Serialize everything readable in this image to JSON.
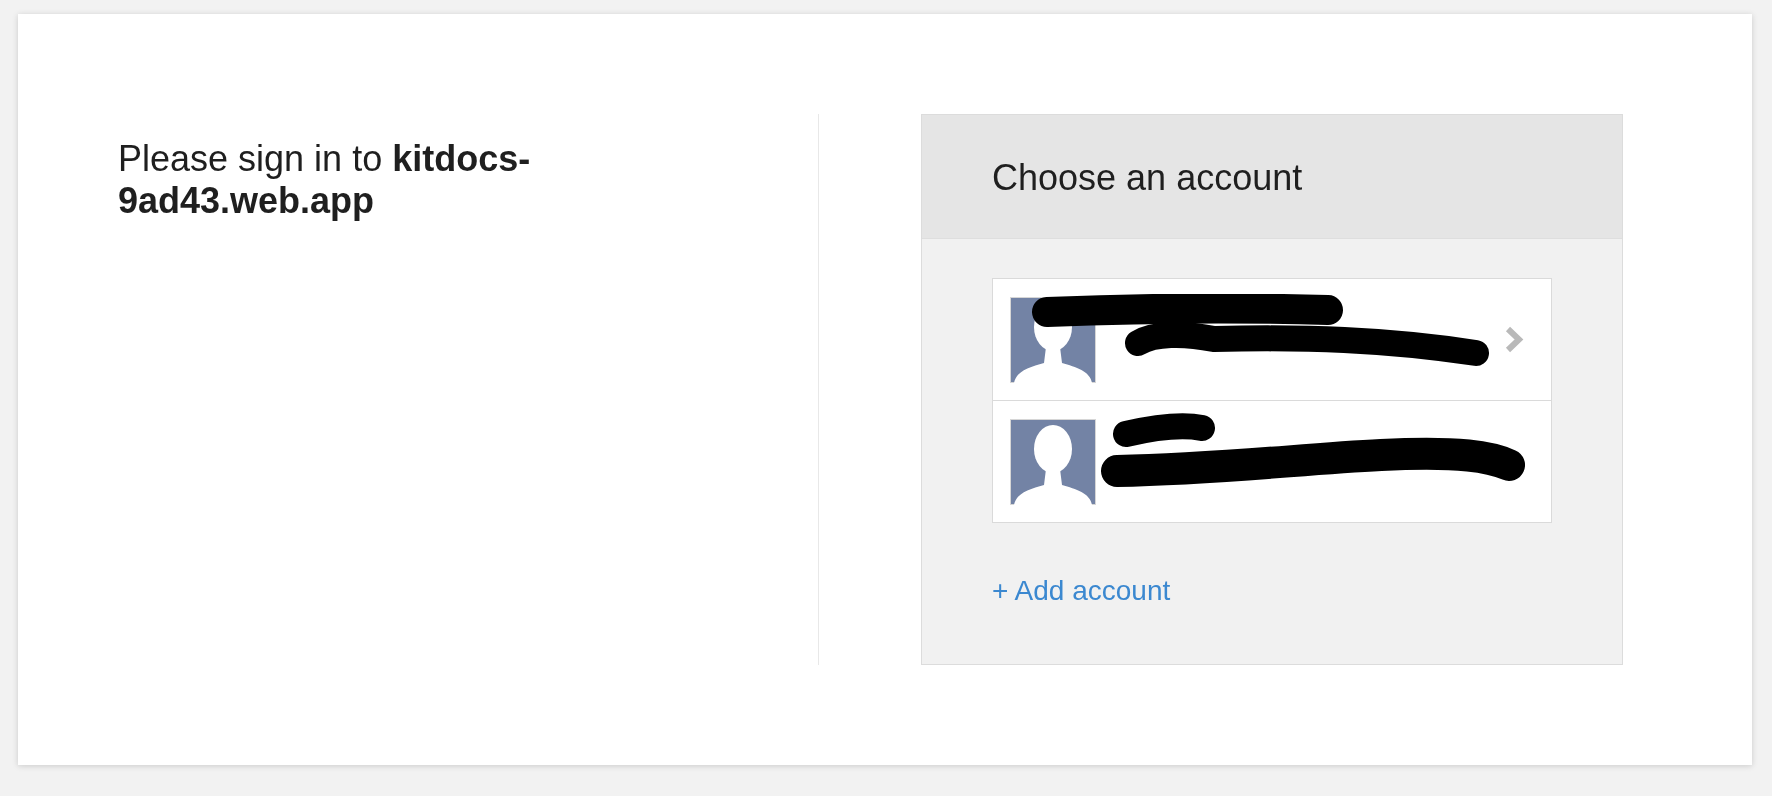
{
  "prompt": {
    "text": "Please sign in to **kitdocs-9ad43.web.app**"
  },
  "account_chooser": {
    "title": "Choose an account",
    "accounts": [
      {
        "redacted": true,
        "arrow": true
      },
      {
        "redacted": true,
        "arrow": false
      }
    ],
    "add_account": "+ Add account"
  }
}
